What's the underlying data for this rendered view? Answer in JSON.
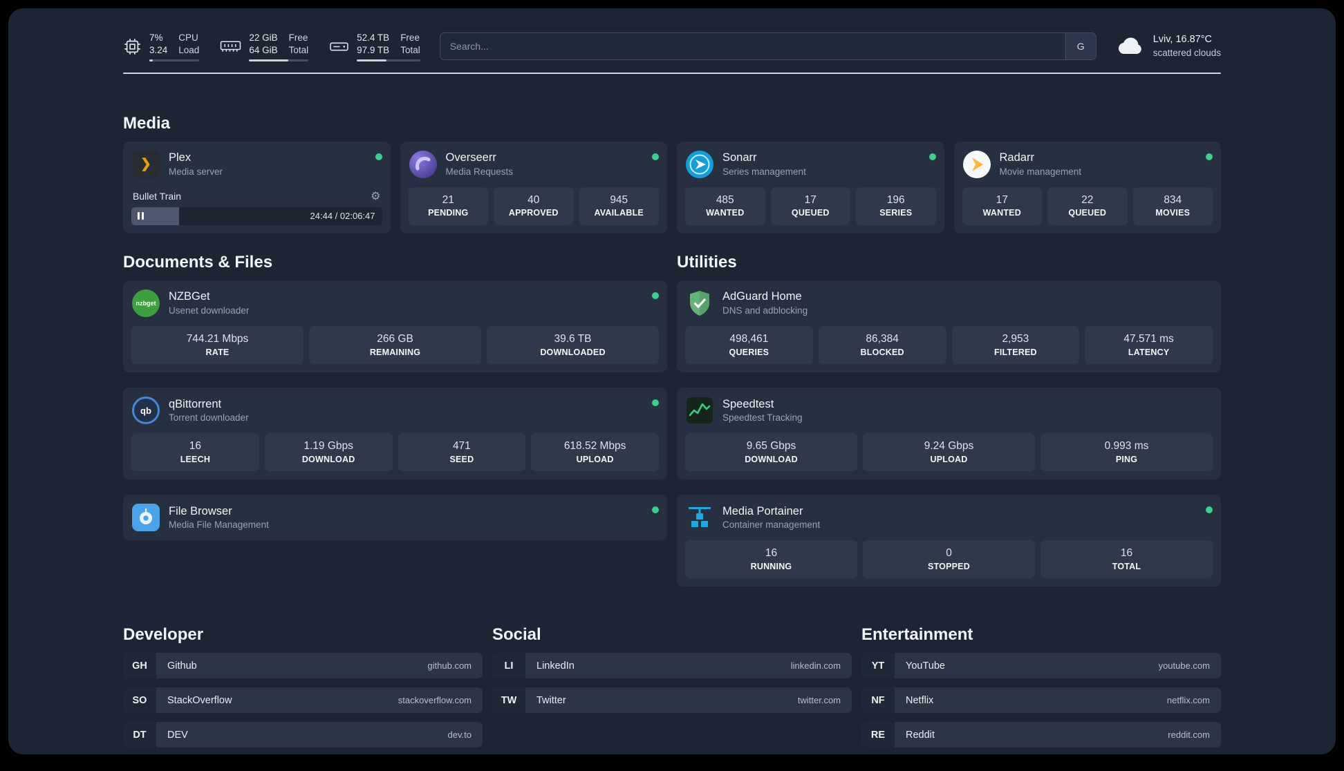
{
  "topbar": {
    "cpu": {
      "value_top": "7%",
      "value_bottom": "3.24",
      "label_top": "CPU",
      "label_bottom": "Load",
      "progress": 7
    },
    "memory": {
      "value_top": "22 GiB",
      "value_bottom": "64 GiB",
      "label_top": "Free",
      "label_bottom": "Total",
      "progress": 66
    },
    "disk": {
      "value_top": "52.4 TB",
      "value_bottom": "97.9 TB",
      "label_top": "Free",
      "label_bottom": "Total",
      "progress": 47
    },
    "search": {
      "placeholder": "Search...",
      "button_label": "G"
    },
    "weather": {
      "location": "Lviv, 16.87°C",
      "condition": "scattered clouds"
    }
  },
  "colors": {
    "accent_green": "#3ecf8e",
    "background": "#1d2535",
    "card": "#273040"
  },
  "sections": {
    "media": {
      "title": "Media",
      "plex": {
        "name": "Plex",
        "subtitle": "Media server",
        "now_playing": "Bullet Train",
        "time": "24:44 / 02:06:47",
        "progress": 19
      },
      "overseerr": {
        "name": "Overseerr",
        "subtitle": "Media Requests",
        "stats": [
          {
            "value": "21",
            "label": "PENDING"
          },
          {
            "value": "40",
            "label": "APPROVED"
          },
          {
            "value": "945",
            "label": "AVAILABLE"
          }
        ]
      },
      "sonarr": {
        "name": "Sonarr",
        "subtitle": "Series management",
        "stats": [
          {
            "value": "485",
            "label": "WANTED"
          },
          {
            "value": "17",
            "label": "QUEUED"
          },
          {
            "value": "196",
            "label": "SERIES"
          }
        ]
      },
      "radarr": {
        "name": "Radarr",
        "subtitle": "Movie management",
        "stats": [
          {
            "value": "17",
            "label": "WANTED"
          },
          {
            "value": "22",
            "label": "QUEUED"
          },
          {
            "value": "834",
            "label": "MOVIES"
          }
        ]
      }
    },
    "documents": {
      "title": "Documents & Files",
      "nzbget": {
        "name": "NZBGet",
        "subtitle": "Usenet downloader",
        "icon_text": "nzbget",
        "stats": [
          {
            "value": "744.21 Mbps",
            "label": "RATE"
          },
          {
            "value": "266 GB",
            "label": "REMAINING"
          },
          {
            "value": "39.6 TB",
            "label": "DOWNLOADED"
          }
        ]
      },
      "qbittorrent": {
        "name": "qBittorrent",
        "subtitle": "Torrent downloader",
        "icon_text": "qb",
        "stats": [
          {
            "value": "16",
            "label": "LEECH"
          },
          {
            "value": "1.19 Gbps",
            "label": "DOWNLOAD"
          },
          {
            "value": "471",
            "label": "SEED"
          },
          {
            "value": "618.52 Mbps",
            "label": "UPLOAD"
          }
        ]
      },
      "filebrowser": {
        "name": "File Browser",
        "subtitle": "Media File Management"
      }
    },
    "utilities": {
      "title": "Utilities",
      "adguard": {
        "name": "AdGuard Home",
        "subtitle": "DNS and adblocking",
        "stats": [
          {
            "value": "498,461",
            "label": "QUERIES"
          },
          {
            "value": "86,384",
            "label": "BLOCKED"
          },
          {
            "value": "2,953",
            "label": "FILTERED"
          },
          {
            "value": "47.571 ms",
            "label": "LATENCY"
          }
        ]
      },
      "speedtest": {
        "name": "Speedtest",
        "subtitle": "Speedtest Tracking",
        "stats": [
          {
            "value": "9.65 Gbps",
            "label": "DOWNLOAD"
          },
          {
            "value": "9.24 Gbps",
            "label": "UPLOAD"
          },
          {
            "value": "0.993 ms",
            "label": "PING"
          }
        ]
      },
      "portainer": {
        "name": "Media Portainer",
        "subtitle": "Container management",
        "stats": [
          {
            "value": "16",
            "label": "RUNNING"
          },
          {
            "value": "0",
            "label": "STOPPED"
          },
          {
            "value": "16",
            "label": "TOTAL"
          }
        ]
      }
    }
  },
  "bookmarks": {
    "developer": {
      "title": "Developer",
      "items": [
        {
          "abbr": "GH",
          "name": "Github",
          "url": "github.com"
        },
        {
          "abbr": "SO",
          "name": "StackOverflow",
          "url": "stackoverflow.com"
        },
        {
          "abbr": "DT",
          "name": "DEV",
          "url": "dev.to"
        }
      ]
    },
    "social": {
      "title": "Social",
      "items": [
        {
          "abbr": "LI",
          "name": "LinkedIn",
          "url": "linkedin.com"
        },
        {
          "abbr": "TW",
          "name": "Twitter",
          "url": "twitter.com"
        }
      ]
    },
    "entertainment": {
      "title": "Entertainment",
      "items": [
        {
          "abbr": "YT",
          "name": "YouTube",
          "url": "youtube.com"
        },
        {
          "abbr": "NF",
          "name": "Netflix",
          "url": "netflix.com"
        },
        {
          "abbr": "RE",
          "name": "Reddit",
          "url": "reddit.com"
        }
      ]
    }
  }
}
